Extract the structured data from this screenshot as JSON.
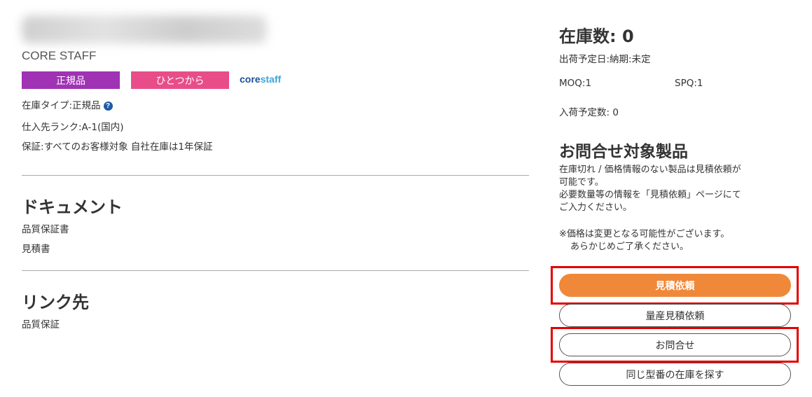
{
  "product": {
    "maker": "CORE STAFF",
    "badges": {
      "genuine": "正規品",
      "single": "ひとつから"
    },
    "logo": {
      "part1": "core",
      "part2": "staff"
    },
    "stock_type": "在庫タイプ:正規品",
    "help_icon": "?",
    "supplier_rank": "仕入先ランク:A-1(国内)",
    "warranty": "保証:すべてのお客様対象 自社在庫は1年保証"
  },
  "documents": {
    "heading": "ドキュメント",
    "items": [
      "品質保証書",
      "見積書"
    ]
  },
  "links": {
    "heading": "リンク先",
    "items": [
      "品質保証"
    ]
  },
  "stock_panel": {
    "stock_count": "在庫数: 0",
    "ship_date": "出荷予定日:納期:未定",
    "moq": "MOQ:1",
    "spq": "SPQ:1",
    "incoming": "入荷予定数: 0",
    "inquiry_heading": "お問合せ対象製品",
    "para1_line1": "在庫切れ / 価格情報のない製品は見積依頼が",
    "para1_line2": "可能です。",
    "para1_line3": "必要数量等の情報を「見積依頼」ページにて",
    "para1_line4": "ご入力ください。",
    "note_line1": "※価格は変更となる可能性がございます。",
    "note_line2": "あらかじめご了承ください。"
  },
  "buttons": {
    "quote": "見積依頼",
    "mass_quote": "量産見積依頼",
    "inquiry": "お問合せ",
    "search_same": "同じ型番の在庫を探す"
  },
  "colors": {
    "genuine_badge": "#a032b4",
    "single_badge": "#e84d8a",
    "primary_button": "#f0883a",
    "highlight": "#e30000",
    "logo_dark": "#1d4f9c",
    "logo_light": "#3aa6dc"
  }
}
